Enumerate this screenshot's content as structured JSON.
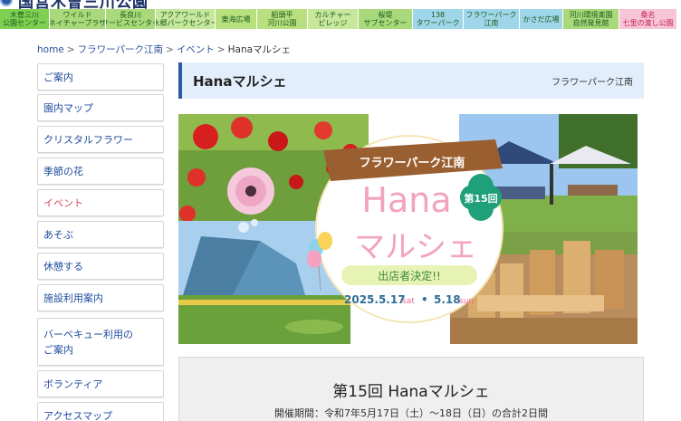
{
  "site": {
    "name": "国営木曽三川公園"
  },
  "park_nav": [
    {
      "lines": [
        "木曽三川",
        "公園センター"
      ],
      "color": "#7fcf52"
    },
    {
      "lines": [
        "ワイルド",
        "ネイチャープラザ"
      ],
      "color": "#a9d97a"
    },
    {
      "lines": [
        "長良川",
        "サービスセンター"
      ],
      "color": "#a9d97a"
    },
    {
      "lines": [
        "アクアワールド",
        "水郷パークセンター"
      ],
      "color": "#c6e79c"
    },
    {
      "lines": [
        "東海広場"
      ],
      "color": "#b8e07e"
    },
    {
      "lines": [
        "船頭平",
        "河川公園"
      ],
      "color": "#b8e07e"
    },
    {
      "lines": [
        "カルチャー",
        "ビレッジ"
      ],
      "color": "#c6e79c"
    },
    {
      "lines": [
        "桜堤",
        "サブセンター"
      ],
      "color": "#a9d97a"
    },
    {
      "lines": [
        "138",
        "タワーパーク"
      ],
      "color": "#9fd6ea"
    },
    {
      "lines": [
        "フラワーパーク",
        "江南"
      ],
      "color": "#9fd6ea"
    },
    {
      "lines": [
        "かさだ広場"
      ],
      "color": "#9fd6ea"
    },
    {
      "lines": [
        "河川環境楽園",
        "自然発見館"
      ],
      "color": "#a9d97a"
    },
    {
      "lines": [
        "桑名",
        "七里の渡し公園"
      ],
      "color": "#f7c6d6",
      "text_color": "#c2185b"
    }
  ],
  "breadcrumb": {
    "home": "home",
    "park": "フラワーパーク江南",
    "section": "イベント",
    "current": "Hanaマルシェ",
    "sep": ">"
  },
  "sidebar": [
    {
      "label": "ご案内",
      "active": false
    },
    {
      "label": "園内マップ",
      "active": false
    },
    {
      "label": "クリスタルフラワー",
      "active": false
    },
    {
      "label": "季節の花",
      "active": false
    },
    {
      "label": "イベント",
      "active": true
    },
    {
      "label": "あそぶ",
      "active": false
    },
    {
      "label": "休憩する",
      "active": false
    },
    {
      "label": "施設利用案内",
      "active": false
    },
    {
      "label": "バーベキュー利用の\nご案内",
      "active": false
    },
    {
      "label": "ボランティア",
      "active": false
    },
    {
      "label": "アクセスマップ",
      "active": false
    }
  ],
  "page": {
    "title": "Hanaマルシェ",
    "area": "フラワーパーク江南"
  },
  "banner": {
    "ribbon": "フラワーパーク江南",
    "hana": "Hana",
    "marche": "マルシェ",
    "edition": "第15回",
    "announce": "出店者決定!!",
    "date1": "2025.5.17",
    "day1": "sat",
    "bullet": "•",
    "date2": "5.18",
    "day2": "sun"
  },
  "event": {
    "title": "第15回 Hanaマルシェ",
    "period": "開催期間：令和7年5月17日（土）～18日（日）の合計2日間"
  },
  "colors": {
    "accent": "#2e5aa0",
    "link": "#2a4f9a",
    "active": "#d24a5a",
    "title_bg": "#e2eefc"
  }
}
